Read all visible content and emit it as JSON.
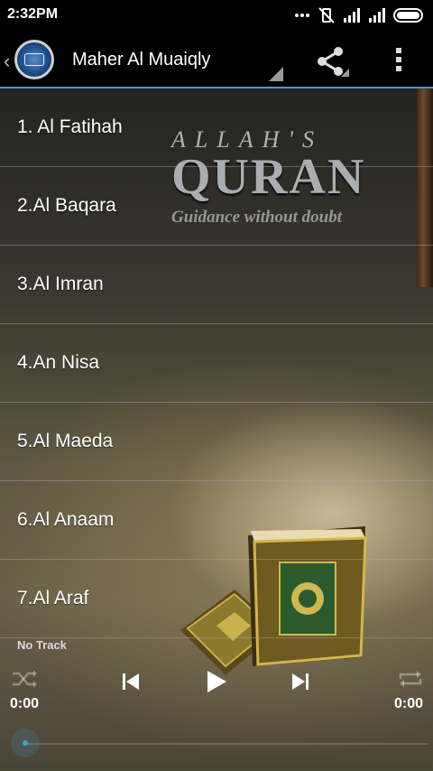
{
  "status_bar": {
    "time": "2:32PM",
    "icons": [
      "more-dots-icon",
      "muted-vibrate-icon",
      "signal-icon",
      "signal-icon",
      "battery-icon"
    ]
  },
  "action_bar": {
    "title": "Maher Al Muaiqly",
    "icons": [
      "back-chevron-icon",
      "app-icon",
      "share-icon",
      "overflow-menu-icon"
    ],
    "accent_color": "#3d9fd6"
  },
  "background": {
    "logo_top": "ALLAH'S",
    "logo_main": "QURAN",
    "logo_sub": "Guidance without doubt"
  },
  "tracks": [
    {
      "label": "1. Al Fatihah"
    },
    {
      "label": "2.Al Baqara"
    },
    {
      "label": "3.Al Imran"
    },
    {
      "label": "4.An Nisa"
    },
    {
      "label": "5.Al Maeda"
    },
    {
      "label": "6.Al Anaam"
    },
    {
      "label": "7.Al Araf"
    }
  ],
  "player": {
    "now_playing": "No Track",
    "elapsed": "0:00",
    "duration": "0:00",
    "progress": 0,
    "controls": [
      "shuffle-icon",
      "previous-icon",
      "play-icon",
      "next-icon",
      "repeat-icon"
    ]
  }
}
